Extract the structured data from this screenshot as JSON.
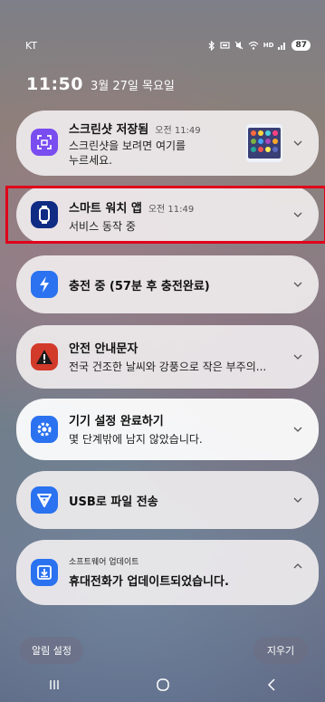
{
  "status_bar": {
    "carrier": "KT",
    "icons": [
      "bluetooth-icon",
      "volume-icon",
      "mute-icon",
      "wifi-icon",
      "hd-icon",
      "signal-icon"
    ],
    "battery": "87"
  },
  "datetime": {
    "time": "11:50",
    "date": "3월 27일 목요일"
  },
  "notifications": [
    {
      "app_icon": "screenshot-icon",
      "icon_color": "#7a4df0",
      "title": "스크린샷 저장됨",
      "time": "오전 11:49",
      "body": "스크린샷을 보려면 여기를\n누르세요."
    },
    {
      "app_icon": "watch-icon",
      "icon_color": "#0f2b84",
      "title": "스마트 워치 앱",
      "time": "오전 11:49",
      "body": "서비스 동작 중"
    },
    {
      "app_icon": "charging-icon",
      "icon_color": "#2a72f0",
      "title": "충전 중 (57분 후 충전완료)",
      "time": "",
      "body": ""
    },
    {
      "app_icon": "warning-icon",
      "icon_color": "#d23a2a",
      "title": "안전 안내문자",
      "time": "",
      "body": "전국 건조한 날씨와 강풍으로 작은 부주의..."
    },
    {
      "app_icon": "settings-icon",
      "icon_color": "#2a72f0",
      "title": "기기 설정 완료하기",
      "time": "",
      "body": "몇 단계밖에 남지 않았습니다."
    },
    {
      "app_icon": "usb-icon",
      "icon_color": "#2a72f0",
      "title": "USB로 파일 전송",
      "time": "",
      "body": ""
    },
    {
      "app_icon": "update-icon",
      "icon_color": "#2a72f0",
      "small_title": "소프트웨어 업데이트",
      "title": "휴대전화가 업데이트되었습니다.",
      "time": "",
      "body": ""
    }
  ],
  "buttons": {
    "notification_settings": "알림 설정",
    "clear": "지우기"
  },
  "nav": {
    "recents": "recents-icon",
    "home": "home-icon",
    "back": "back-icon"
  },
  "colors": {
    "highlight": "#e0001a"
  }
}
